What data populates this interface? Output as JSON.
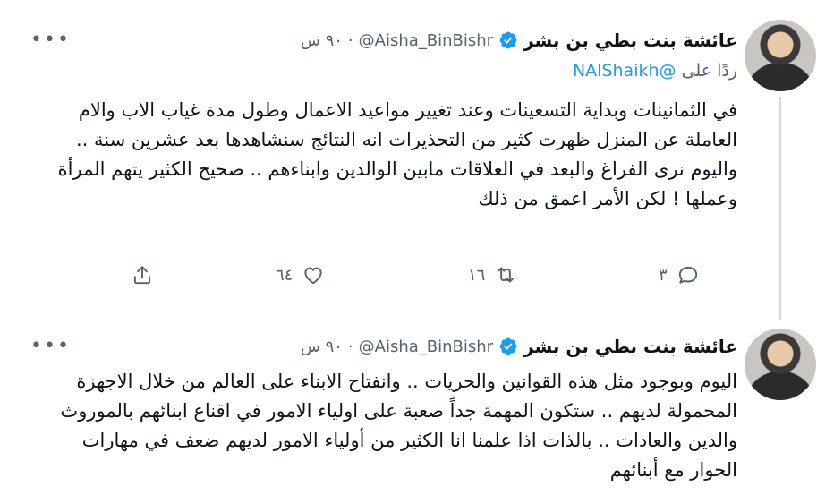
{
  "tweets": [
    {
      "author_name": "عائشة بنت بطي بن بشر",
      "handle": "@Aisha_BinBishr",
      "separator": "·",
      "time": "٩٠ س",
      "more": "•••",
      "reply_prefix": "ردًا على",
      "reply_mention": "@NAlShaikh",
      "text": "في الثمانينات وبداية التسعينات وعند تغيير مواعيد الاعمال وطول مدة غياب الاب والام العاملة عن المنزل ظهرت كثير من التحذيرات انه النتائج سنشاهدها بعد عشرين سنة .. واليوم نرى الفراغ والبعد في العلاقات مابين الوالدين وابناءهم .. صحيح الكثير يتهم المرأة وعملها ! لكن الأمر اعمق من ذلك",
      "reply_count": "٣",
      "retweet_count": "١٦",
      "like_count": "٦٤"
    },
    {
      "author_name": "عائشة بنت بطي بن بشر",
      "handle": "@Aisha_BinBishr",
      "separator": "·",
      "time": "٩٠ س",
      "more": "•••",
      "text": "اليوم وبوجود مثل هذه القوانين والحريات .. وانفتاح الابناء على العالم من خلال الاجهزة المحمولة لديهم .. ستكون المهمة جداً صعبة على اولياء الامور في اقناع ابنائهم بالموروث والدين والعادات .. بالذات اذا علمنا انا الكثير من أولياء الامور لديهم ضعف في مهارات الحوار مع أبنائهم"
    }
  ]
}
